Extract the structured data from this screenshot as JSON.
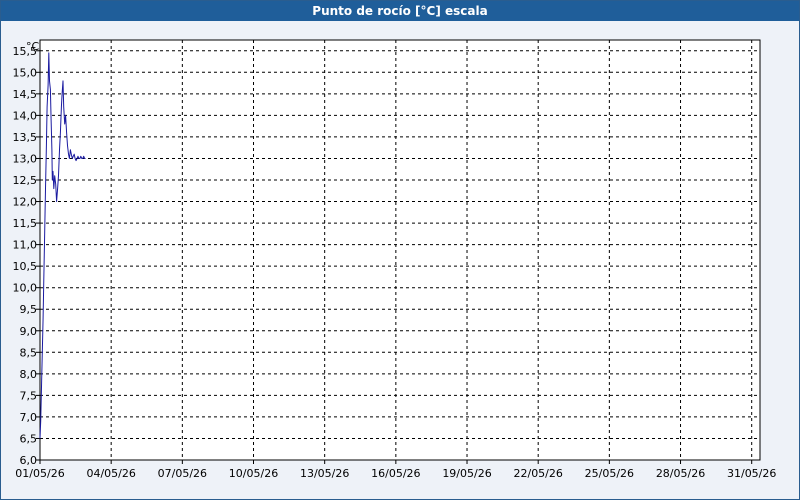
{
  "window": {
    "title": "Punto de rocío [°C] escala"
  },
  "colors": {
    "title_bar": "#1f5e9a",
    "title_text": "#ffffff",
    "background": "#eef2f8",
    "plot_background": "#ffffff",
    "grid": "#000000",
    "series": "#1a1aa0"
  },
  "chart_data": {
    "type": "line",
    "title": "Punto de rocío [°C] escala",
    "ylabel": "°C",
    "xlabel": "",
    "ylim": [
      6.0,
      15.75
    ],
    "xlim": [
      0,
      30.35
    ],
    "grid": true,
    "grid_style": "dashed",
    "x_tick_labels": [
      "01/05/26",
      "04/05/26",
      "07/05/26",
      "10/05/26",
      "13/05/26",
      "16/05/26",
      "19/05/26",
      "22/05/26",
      "25/05/26",
      "28/05/26",
      "31/05/26"
    ],
    "y_tick_labels": [
      "6,0",
      "6,5",
      "7,0",
      "7,5",
      "8,0",
      "8,5",
      "9,0",
      "9,5",
      "10,0",
      "10,5",
      "11,0",
      "11,5",
      "12,0",
      "12,5",
      "13,0",
      "13,5",
      "14,0",
      "14,5",
      "15,0",
      "15,5"
    ],
    "series": [
      {
        "x": [
          0,
          0.03,
          0.06,
          0.1,
          0.13,
          0.16,
          0.2,
          0.23,
          0.27,
          0.3,
          0.34,
          0.37,
          0.4,
          0.44,
          0.47,
          0.5,
          0.52,
          0.55,
          0.58,
          0.62,
          0.66,
          0.7,
          0.74,
          0.78,
          0.82,
          0.86,
          0.9,
          0.93,
          0.97,
          1.0,
          1.04,
          1.08,
          1.12,
          1.16,
          1.2,
          1.24,
          1.28,
          1.32,
          1.36,
          1.4,
          1.44,
          1.48,
          1.52,
          1.56,
          1.6,
          1.64,
          1.68,
          1.72,
          1.76,
          1.8,
          1.84,
          1.88,
          1.92
        ],
        "y": [
          6.5,
          6.9,
          7.6,
          8.6,
          9.3,
          10.2,
          11.3,
          12.3,
          13.3,
          14.2,
          14.7,
          15.45,
          14.8,
          14.6,
          13.9,
          13.2,
          12.5,
          12.7,
          12.3,
          12.6,
          12.4,
          12.0,
          12.3,
          12.6,
          13.2,
          13.6,
          14.2,
          14.5,
          14.8,
          14.2,
          13.8,
          14.0,
          13.6,
          13.3,
          13.1,
          13.0,
          13.2,
          13.1,
          13.0,
          13.05,
          13.1,
          13.0,
          12.95,
          13.0,
          13.05,
          13.0,
          13.0,
          13.05,
          13.0,
          13.0,
          13.05,
          13.0,
          13.0
        ]
      }
    ]
  }
}
